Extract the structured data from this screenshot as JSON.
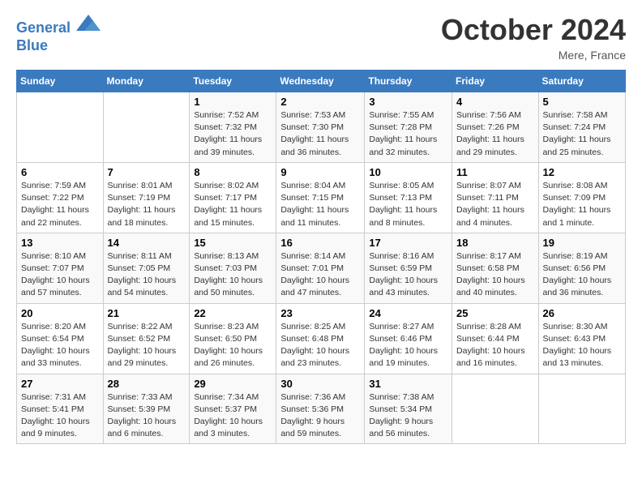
{
  "header": {
    "logo_line1": "General",
    "logo_line2": "Blue",
    "month_title": "October 2024",
    "location": "Mere, France"
  },
  "weekdays": [
    "Sunday",
    "Monday",
    "Tuesday",
    "Wednesday",
    "Thursday",
    "Friday",
    "Saturday"
  ],
  "weeks": [
    [
      {
        "day": "",
        "info": ""
      },
      {
        "day": "",
        "info": ""
      },
      {
        "day": "1",
        "info": "Sunrise: 7:52 AM\nSunset: 7:32 PM\nDaylight: 11 hours and 39 minutes."
      },
      {
        "day": "2",
        "info": "Sunrise: 7:53 AM\nSunset: 7:30 PM\nDaylight: 11 hours and 36 minutes."
      },
      {
        "day": "3",
        "info": "Sunrise: 7:55 AM\nSunset: 7:28 PM\nDaylight: 11 hours and 32 minutes."
      },
      {
        "day": "4",
        "info": "Sunrise: 7:56 AM\nSunset: 7:26 PM\nDaylight: 11 hours and 29 minutes."
      },
      {
        "day": "5",
        "info": "Sunrise: 7:58 AM\nSunset: 7:24 PM\nDaylight: 11 hours and 25 minutes."
      }
    ],
    [
      {
        "day": "6",
        "info": "Sunrise: 7:59 AM\nSunset: 7:22 PM\nDaylight: 11 hours and 22 minutes."
      },
      {
        "day": "7",
        "info": "Sunrise: 8:01 AM\nSunset: 7:19 PM\nDaylight: 11 hours and 18 minutes."
      },
      {
        "day": "8",
        "info": "Sunrise: 8:02 AM\nSunset: 7:17 PM\nDaylight: 11 hours and 15 minutes."
      },
      {
        "day": "9",
        "info": "Sunrise: 8:04 AM\nSunset: 7:15 PM\nDaylight: 11 hours and 11 minutes."
      },
      {
        "day": "10",
        "info": "Sunrise: 8:05 AM\nSunset: 7:13 PM\nDaylight: 11 hours and 8 minutes."
      },
      {
        "day": "11",
        "info": "Sunrise: 8:07 AM\nSunset: 7:11 PM\nDaylight: 11 hours and 4 minutes."
      },
      {
        "day": "12",
        "info": "Sunrise: 8:08 AM\nSunset: 7:09 PM\nDaylight: 11 hours and 1 minute."
      }
    ],
    [
      {
        "day": "13",
        "info": "Sunrise: 8:10 AM\nSunset: 7:07 PM\nDaylight: 10 hours and 57 minutes."
      },
      {
        "day": "14",
        "info": "Sunrise: 8:11 AM\nSunset: 7:05 PM\nDaylight: 10 hours and 54 minutes."
      },
      {
        "day": "15",
        "info": "Sunrise: 8:13 AM\nSunset: 7:03 PM\nDaylight: 10 hours and 50 minutes."
      },
      {
        "day": "16",
        "info": "Sunrise: 8:14 AM\nSunset: 7:01 PM\nDaylight: 10 hours and 47 minutes."
      },
      {
        "day": "17",
        "info": "Sunrise: 8:16 AM\nSunset: 6:59 PM\nDaylight: 10 hours and 43 minutes."
      },
      {
        "day": "18",
        "info": "Sunrise: 8:17 AM\nSunset: 6:58 PM\nDaylight: 10 hours and 40 minutes."
      },
      {
        "day": "19",
        "info": "Sunrise: 8:19 AM\nSunset: 6:56 PM\nDaylight: 10 hours and 36 minutes."
      }
    ],
    [
      {
        "day": "20",
        "info": "Sunrise: 8:20 AM\nSunset: 6:54 PM\nDaylight: 10 hours and 33 minutes."
      },
      {
        "day": "21",
        "info": "Sunrise: 8:22 AM\nSunset: 6:52 PM\nDaylight: 10 hours and 29 minutes."
      },
      {
        "day": "22",
        "info": "Sunrise: 8:23 AM\nSunset: 6:50 PM\nDaylight: 10 hours and 26 minutes."
      },
      {
        "day": "23",
        "info": "Sunrise: 8:25 AM\nSunset: 6:48 PM\nDaylight: 10 hours and 23 minutes."
      },
      {
        "day": "24",
        "info": "Sunrise: 8:27 AM\nSunset: 6:46 PM\nDaylight: 10 hours and 19 minutes."
      },
      {
        "day": "25",
        "info": "Sunrise: 8:28 AM\nSunset: 6:44 PM\nDaylight: 10 hours and 16 minutes."
      },
      {
        "day": "26",
        "info": "Sunrise: 8:30 AM\nSunset: 6:43 PM\nDaylight: 10 hours and 13 minutes."
      }
    ],
    [
      {
        "day": "27",
        "info": "Sunrise: 7:31 AM\nSunset: 5:41 PM\nDaylight: 10 hours and 9 minutes."
      },
      {
        "day": "28",
        "info": "Sunrise: 7:33 AM\nSunset: 5:39 PM\nDaylight: 10 hours and 6 minutes."
      },
      {
        "day": "29",
        "info": "Sunrise: 7:34 AM\nSunset: 5:37 PM\nDaylight: 10 hours and 3 minutes."
      },
      {
        "day": "30",
        "info": "Sunrise: 7:36 AM\nSunset: 5:36 PM\nDaylight: 9 hours and 59 minutes."
      },
      {
        "day": "31",
        "info": "Sunrise: 7:38 AM\nSunset: 5:34 PM\nDaylight: 9 hours and 56 minutes."
      },
      {
        "day": "",
        "info": ""
      },
      {
        "day": "",
        "info": ""
      }
    ]
  ]
}
